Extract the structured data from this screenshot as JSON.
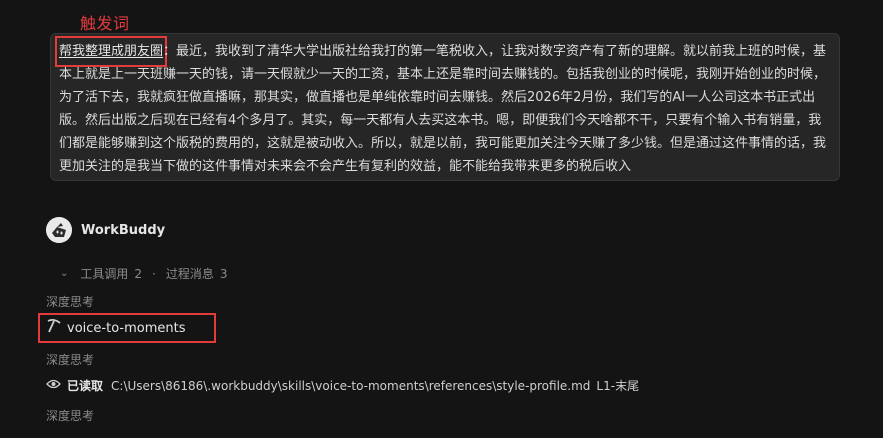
{
  "annotation": {
    "label": "触发词",
    "color": "#e23b3b"
  },
  "user_message": {
    "trigger_word": "帮我整理成朋友圈",
    "separator": "：",
    "body": "最近，我收到了清华大学出版社给我打的第一笔税收入，让我对数字资产有了新的理解。就以前我上班的时候，基本上就是上一天班赚一天的钱，请一天假就少一天的工资，基本上还是靠时间去赚钱的。包括我创业的时候呢，我刚开始创业的时候，为了活下去，我就疯狂做直播嘛，那其实，做直播也是单纯依靠时间去赚钱。然后2026年2月份，我们写的AI一人公司这本书正式出版。然后出版之后现在已经有4个多月了。其实，每一天都有人去买这本书。嗯，即便我们今天啥都不干，只要有个输入书有销量，我们都是能够赚到这个版税的费用的，这就是被动收入。所以，就是以前，我可能更加关注今天赚了多少钱。但是通过这件事情的话，我更加关注的是我当下做的这件事情对未来会不会产生有复利的效益，能不能给我带来更多的税后收入"
  },
  "assistant": {
    "name": "WorkBuddy",
    "avatar_icon": "workbuddy-robot-icon"
  },
  "stats": {
    "tool_calls_label": "工具调用",
    "tool_calls_count": "2",
    "dot": "·",
    "process_label": "过程消息",
    "process_count": "3"
  },
  "steps": {
    "deep_think_1": "深度思考",
    "skill_icon": "pickaxe-icon",
    "skill_name": "voice-to-moments",
    "deep_think_2": "深度思考",
    "read_icon": "eye-icon",
    "read_label": "已读取",
    "read_path": "C:\\Users\\86186\\.workbuddy\\skills\\voice-to-moments\\references\\style-profile.md",
    "read_range": "L1-末尾",
    "deep_think_3": "深度思考"
  }
}
